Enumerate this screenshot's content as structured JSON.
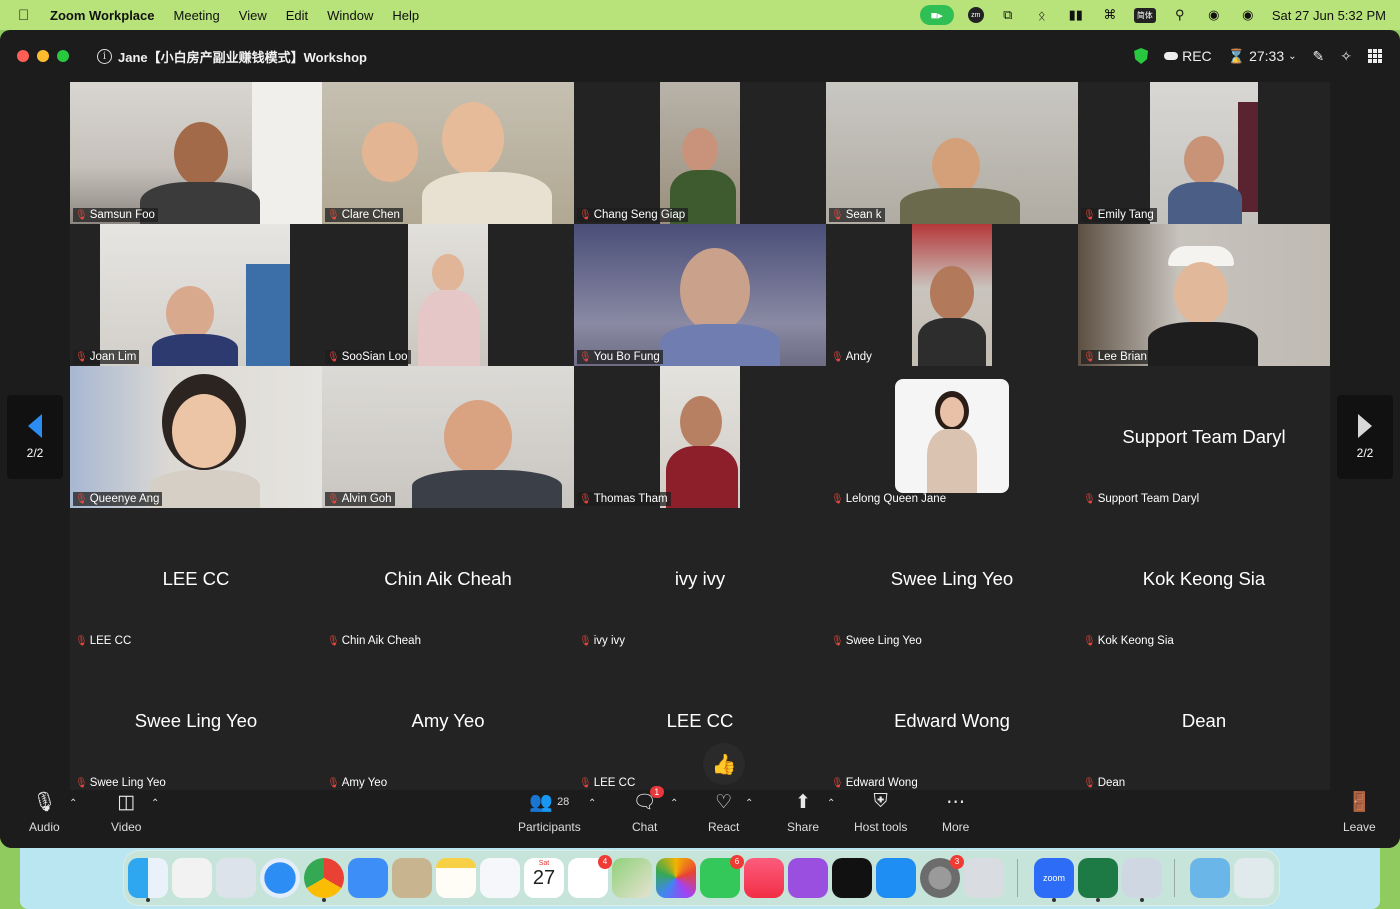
{
  "menubar": {
    "app_name": "Zoom Workplace",
    "menus": [
      "Meeting",
      "View",
      "Edit",
      "Window",
      "Help"
    ],
    "status_icons": [
      "zoom-camera-icon",
      "zoom-mini-icon",
      "screen-mirror-icon",
      "bluetooth-icon",
      "battery-icon",
      "wifi-icon",
      "input-source-icon",
      "spotlight-search-icon",
      "siri-icon",
      "control-center-icon"
    ],
    "input_source": "简体",
    "clock": "Sat 27 Jun  5:32 PM"
  },
  "window": {
    "meeting_title": "Jane【小白房产副业赚钱模式】Workshop",
    "rec_label": "REC",
    "timer": "27:33"
  },
  "page_indicator": "2/2",
  "participants": [
    {
      "name": "Samsun Foo"
    },
    {
      "name": "Clare Chen"
    },
    {
      "name": "Chang Seng Giap"
    },
    {
      "name": "Sean k"
    },
    {
      "name": "Emily Tang"
    },
    {
      "name": "Joan Lim"
    },
    {
      "name": "SooSian Loo"
    },
    {
      "name": "You Bo Fung"
    },
    {
      "name": "Andy"
    },
    {
      "name": "Lee Brian"
    },
    {
      "name": "Queenye Ang"
    },
    {
      "name": "Alvin Goh"
    },
    {
      "name": "Thomas Tham"
    },
    {
      "name": "Lelong Queen Jane"
    },
    {
      "name": "Support Team Daryl",
      "display": "Support Team Daryl"
    },
    {
      "name": "LEE CC",
      "display": "LEE CC"
    },
    {
      "name": "Chin Aik Cheah",
      "display": "Chin Aik Cheah"
    },
    {
      "name": "ivy ivy",
      "display": "ivy ivy"
    },
    {
      "name": "Swee Ling Yeo",
      "display": "Swee Ling Yeo"
    },
    {
      "name": "Kok Keong Sia",
      "display": "Kok Keong Sia"
    },
    {
      "name": "Swee Ling Yeo",
      "display": "Swee Ling Yeo"
    },
    {
      "name": "Amy Yeo",
      "display": "Amy Yeo"
    },
    {
      "name": "LEE CC",
      "display": "LEE CC"
    },
    {
      "name": "Edward Wong",
      "display": "Edward Wong"
    },
    {
      "name": "Dean",
      "display": "Dean"
    }
  ],
  "toolbar": {
    "audio": "Audio",
    "video": "Video",
    "participants": "Participants",
    "participants_count": "28",
    "chat": "Chat",
    "chat_badge": "1",
    "react": "React",
    "share": "Share",
    "host_tools": "Host tools",
    "more": "More",
    "leave": "Leave"
  },
  "dock": {
    "calendar_day": "Sat",
    "calendar_date": "27",
    "reminders_badge": "4",
    "messages_badge": "6",
    "settings_badge": "3",
    "zoom_label": "zoom"
  }
}
